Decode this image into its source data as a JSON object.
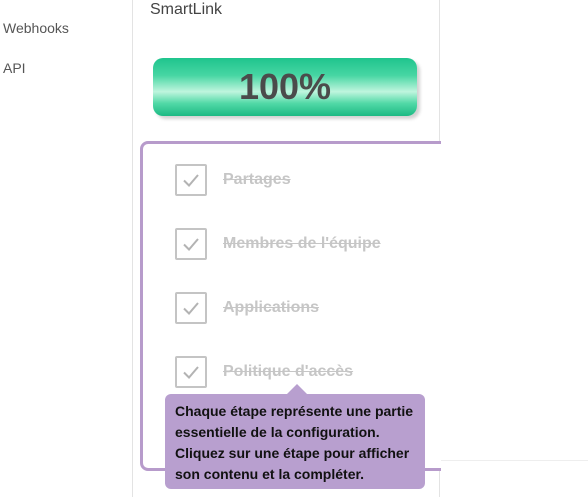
{
  "nav": {
    "items": [
      {
        "label": "Webhooks"
      },
      {
        "label": "API"
      }
    ]
  },
  "panel": {
    "title": "SmartLink",
    "progress": {
      "value": 100,
      "label": "100%"
    },
    "steps": [
      {
        "label": "Partages",
        "completed": true
      },
      {
        "label": "Membres de l'équipe",
        "completed": true
      },
      {
        "label": "Applications",
        "completed": true
      },
      {
        "label": "Politique d'accès",
        "completed": true
      }
    ]
  },
  "tooltip": {
    "text": "Chaque étape représente une partie essentielle de la configuration. Cliquez sur une étape pour afficher son contenu et la compléter."
  },
  "colors": {
    "progress_accent": "#2ecf96",
    "step_frame": "#b79bcb",
    "tooltip_bg": "#b89fcf",
    "completed_text": "#c6c6c6"
  },
  "icons": {
    "step_check": "check-icon"
  }
}
